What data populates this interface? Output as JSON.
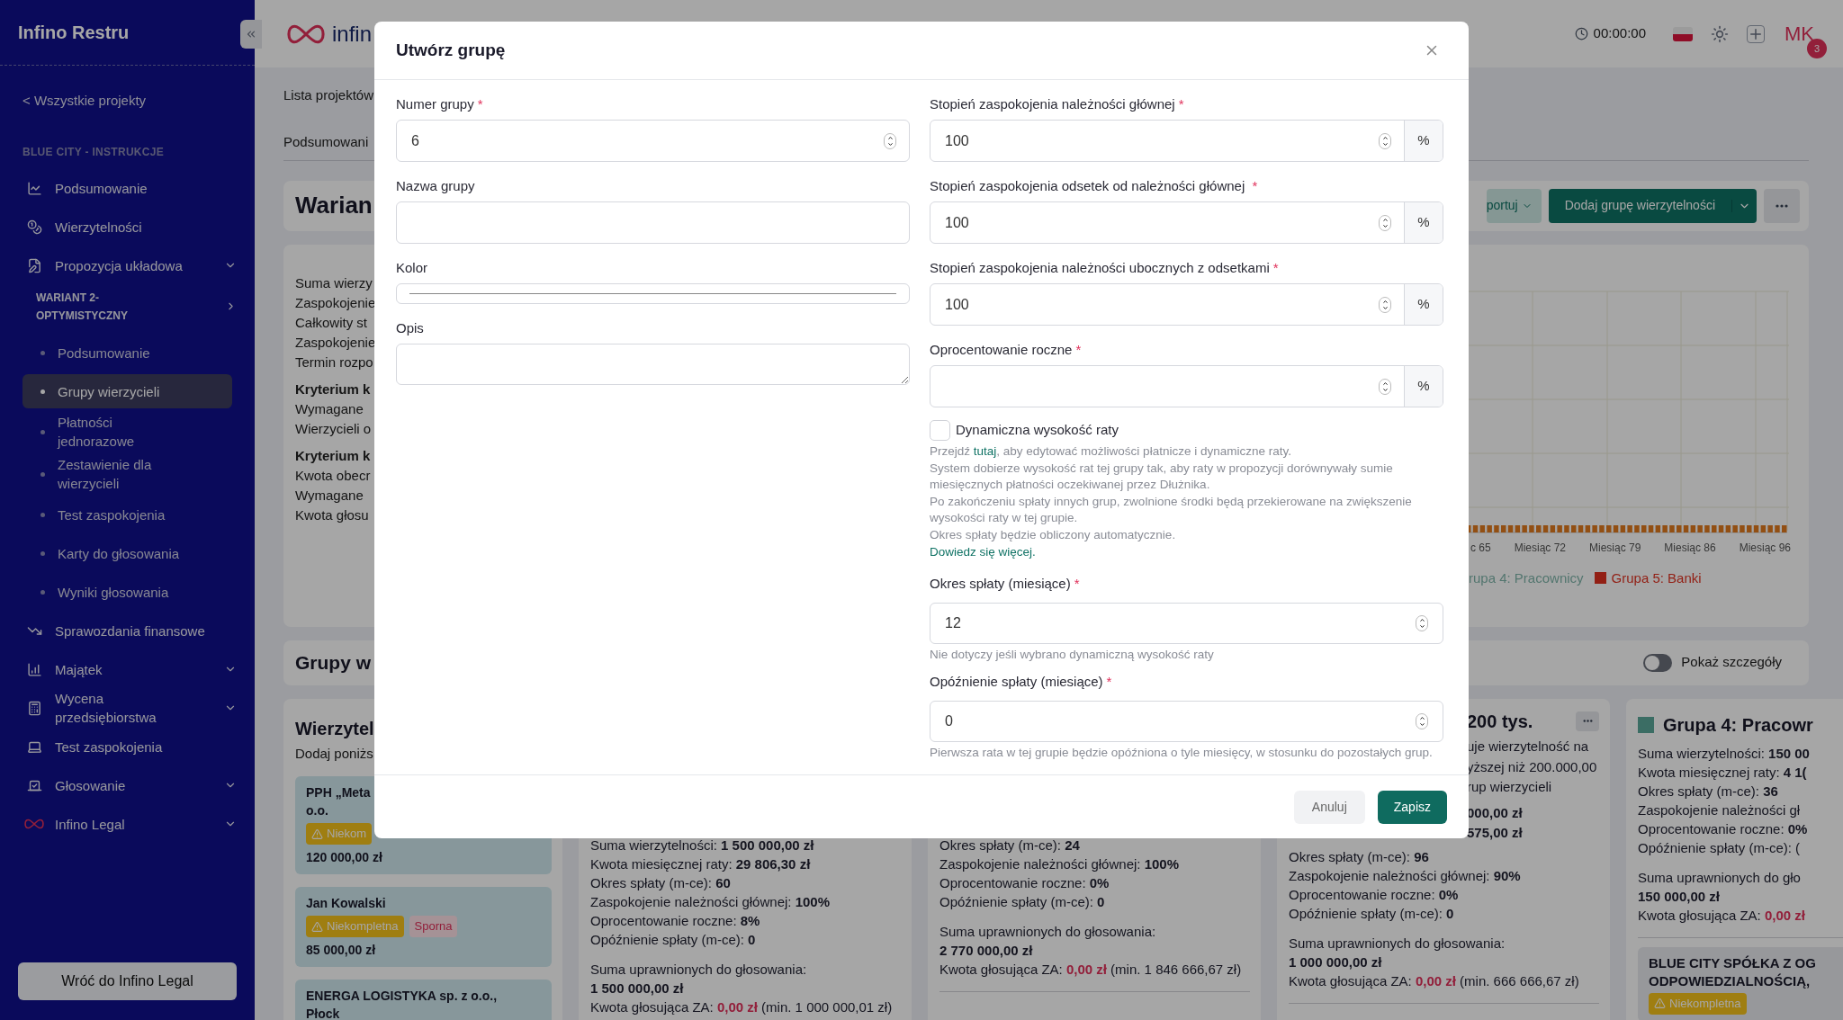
{
  "sidebar": {
    "title": "Infino Restru",
    "back_link": "< Wszystkie projekty",
    "section": "BLUE CITY - INSTRUKCJE",
    "items": [
      {
        "label": "Podsumowanie",
        "dropdown": false
      },
      {
        "label": "Wierzytelności",
        "dropdown": false
      },
      {
        "label": "Propozycja układowa",
        "dropdown": true,
        "children": [
          {
            "label": "WARIANT 2-OPTYMISTYCZNY",
            "children": [
              {
                "label": "Podsumowanie",
                "selected": false
              },
              {
                "label": "Grupy wierzycieli",
                "selected": true
              },
              {
                "label": "Płatności jednorazowe",
                "selected": false
              },
              {
                "label": "Zestawienie dla wierzycieli",
                "selected": false
              },
              {
                "label": "Test zaspokojenia",
                "selected": false
              },
              {
                "label": "Karty do głosowania",
                "selected": false
              },
              {
                "label": "Wyniki głosowania",
                "selected": false
              }
            ]
          }
        ]
      },
      {
        "label": "Sprawozdania finansowe",
        "dropdown": false
      },
      {
        "label": "Majątek",
        "dropdown": true
      },
      {
        "label": "Wycena przedsiębiorstwa",
        "dropdown": true
      },
      {
        "label": "Test zaspokojenia",
        "dropdown": false
      },
      {
        "label": "Głosowanie",
        "dropdown": true
      },
      {
        "label": "Infino Legal",
        "dropdown": true
      }
    ],
    "footer_button": "Wróć do Infino Legal"
  },
  "header": {
    "logo": "infin",
    "timer": "00:00:00",
    "avatar": "MK",
    "notifications": "3"
  },
  "breadcrumb": "Lista projektów",
  "tab": "Podsumowani",
  "variant": {
    "title": "Warian",
    "buttons": [
      {
        "label": "portuj",
        "kind": "secondary"
      },
      {
        "label": "Dodaj grupę wierzytelności",
        "kind": "primary"
      }
    ]
  },
  "summary": {
    "lines": [
      {
        "text": "Suma wierzy",
        "bold": false
      },
      {
        "text": "Zaspokojenie",
        "bold": false
      },
      {
        "text": "Całkowity st",
        "bold": false
      },
      {
        "text": "Zaspokojenie",
        "bold": false
      },
      {
        "text": "Termin rozpo",
        "bold": false
      },
      {
        "text": "Kryterium k",
        "bold": true
      },
      {
        "text": "Wymagane",
        "bold": false
      },
      {
        "text": "Wierzycieli o",
        "bold": false
      },
      {
        "text": "Kryterium k",
        "bold": true
      },
      {
        "text": "Kwota obecr",
        "bold": false
      },
      {
        "text": "Wymagane",
        "bold": false
      },
      {
        "text": "Kwota głosu",
        "bold": false
      }
    ],
    "axis_labels": [
      "c 65",
      "Miesiąc 72",
      "Miesiąc 79",
      "Miesiąc 86",
      "Miesiąc 96"
    ],
    "legend": [
      {
        "label": "rupa 4: Pracownicy",
        "color": "#53766f",
        "swatch": false
      },
      {
        "label": "Grupa 5: Banki",
        "color": "#921f14",
        "swatch": true
      }
    ]
  },
  "groups_section": {
    "title": "Grupy w",
    "toggle_label": "Pokaż szczegóły",
    "toggle_on": false
  },
  "creditors_card": {
    "title": "Wierzytel",
    "subtitle": "Dodaj poniżs",
    "creditors": [
      {
        "name": "PPH „Meta",
        "name_line2": "o.o.",
        "badges": [
          {
            "label": "Niekom",
            "kind": "warning"
          }
        ],
        "amount": "120 000,00 zł"
      },
      {
        "name": "Jan Kowalski",
        "badges": [
          {
            "label": "Niekompletna",
            "kind": "warning"
          },
          {
            "label": "Sporna",
            "kind": "danger"
          }
        ],
        "amount": "85 000,00 zł"
      },
      {
        "name": "ENERGA LOGISTYKA sp. z o.o.,",
        "name_line2": "Płock"
      }
    ]
  },
  "group_cards": [
    {
      "stats": [
        "Suma wierzytelności: **1 500 000,00 zł**",
        "Kwota miesięcznej raty: **29 806,30 zł**",
        "Okres spłaty (m-ce): **60**",
        "Zaspokojenie należności głównej: **100%**",
        "Oprocentowanie roczne: **8%**",
        "Opóźnienie spłaty (m-ce): **0**"
      ],
      "vote_label": "Suma uprawnionych do głosowania:",
      "vote_amount": "1 500 000,00 zł",
      "za_label": "Kwota głosująca ZA:",
      "za_value": "0,00 zł",
      "za_note": "(min. 1 000 000,01 zł)"
    },
    {
      "stats": [
        "Okres spłaty (m-ce): **24**",
        "Zaspokojenie należności głównej: **100%**",
        "Oprocentowanie roczne: **0%**",
        "Opóźnienie spłaty (m-ce): **0**"
      ],
      "vote_label": "Suma uprawnionych do głosowania:",
      "vote_amount": "2 770 000,00 zł",
      "za_label": "Kwota głosująca ZA:",
      "za_value": "0,00 zł",
      "za_note": "(min. 1 846 666,67 zł)"
    },
    {
      "title": "200 tys.",
      "fragments": [
        "uje wierzytelność na",
        "yższej niż 200.000,00",
        "rup wierzycieli",
        "**000,00 zł**",
        "**575,00 zł**"
      ],
      "stats": [
        "Okres spłaty (m-ce): **96**",
        "Zaspokojenie należności głównej: **90%**",
        "Oprocentowanie roczne: **0%**",
        "Opóźnienie spłaty (m-ce): **0**"
      ],
      "vote_label": "Suma uprawnionych do głosowania:",
      "vote_amount": "1 000 000,00 zł",
      "za_label": "Kwota głosująca ZA:",
      "za_value": "0,00 zł",
      "za_note": "(min. 666 666,67 zł)"
    },
    {
      "title": "Grupa 4: Pracowr",
      "color": "#3b6d64",
      "stats": [
        "Suma wierzytelności: **150 00**",
        "Kwota miesięcznej raty: **4 1(**",
        "Okres spłaty (m-ce): **36**",
        "Zaspokojenie należności gł",
        "Oprocentowanie roczne: **0%**",
        "Opóźnienie spłaty (m-ce): ("
      ],
      "vote_label": "Suma uprawnionych do gło",
      "vote_amount": "150 000,00 zł",
      "za_label": "Kwota głosująca ZA:",
      "za_value": "0,00 zł",
      "creditor": {
        "name": "BLUE CITY SPÓŁKA Z OG",
        "name_line2": "ODPOWIEDZIALNOŚCIĄ,",
        "badge": "Niekompletna"
      }
    }
  ],
  "modal": {
    "title": "Utwórz grupę",
    "left": [
      {
        "kind": "number",
        "label": "Numer grupy",
        "required_mark": "*",
        "value": "6"
      },
      {
        "kind": "text",
        "label": "Nazwa grupy"
      },
      {
        "kind": "color",
        "label": "Kolor"
      },
      {
        "kind": "textarea",
        "label": "Opis"
      }
    ],
    "right": [
      {
        "label": "Stopień zaspokojenia należności głównej",
        "required_mark": "*",
        "value": "100",
        "unit": "%"
      },
      {
        "label": "Stopień zaspokojenia odsetek od należności głównej ",
        "required_mark": "*",
        "value": "100",
        "unit": "%"
      },
      {
        "label": "Stopień zaspokojenia należności ubocznych z odsetkami",
        "required_mark": "*",
        "value": "100",
        "unit": "%"
      },
      {
        "label": "Oprocentowanie roczne",
        "required_mark": "*",
        "unit": "%"
      }
    ],
    "dynamic": {
      "label": "Dynamiczna wysokość raty",
      "checked": false,
      "intro_before": "Przejdź ",
      "intro_link": "tutaj",
      "intro_after": ", aby edytować możliwości płatnicze i dynamiczne raty.",
      "lines": [
        "System dobierze wysokość rat tej grupy tak, aby raty w propozycji dorównywały sumie miesięcznych płatności oczekiwanej przez Dłużnika.",
        "Po zakończeniu spłaty innych grup, zwolnione środki będą przekierowane na zwiększenie wysokości raty w tej grupie.",
        "Okres spłaty będzie obliczony automatycznie."
      ],
      "more_link": "Dowiedz się więcej."
    },
    "lower": [
      {
        "label": "Okres spłaty (miesiące)",
        "required_mark": "*",
        "value": "12",
        "hint": "Nie dotyczy jeśli wybrano dynamiczną wysokość raty"
      },
      {
        "label": "Opóźnienie spłaty (miesiące)",
        "required_mark": "*",
        "value": "0",
        "hint": "Pierwsza rata w tej grupie będzie opóźniona o tyle miesięcy, w stosunku do pozostałych grup."
      }
    ],
    "cancel": "Anuluj",
    "save": "Zapisz"
  }
}
